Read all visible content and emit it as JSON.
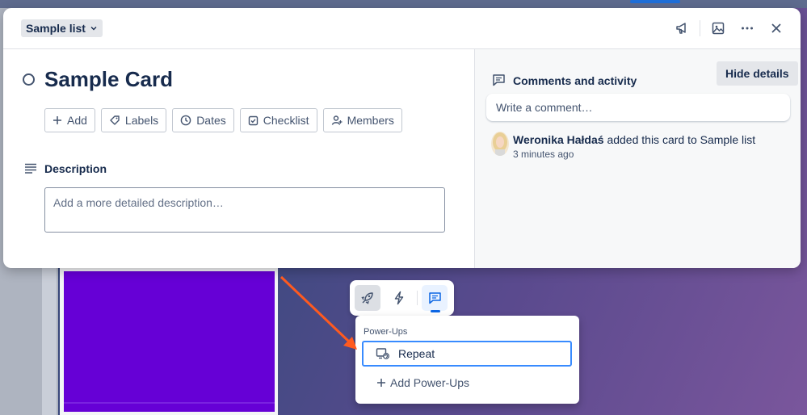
{
  "modal": {
    "list_name": "Sample list",
    "card_title": "Sample Card",
    "actions": [
      "Add",
      "Labels",
      "Dates",
      "Checklist",
      "Members"
    ],
    "description_label": "Description",
    "description_placeholder": "Add a more detailed description…"
  },
  "activity": {
    "title": "Comments and activity",
    "hide_details": "Hide details",
    "comment_placeholder": "Write a comment…",
    "user": "Weronika Hałdaś",
    "action_text": " added this card to Sample list",
    "time": "3 minutes ago"
  },
  "powerups": {
    "heading": "Power-Ups",
    "repeat": "Repeat",
    "add": "Add Power-Ups"
  },
  "colors": {
    "accent": "#0c66e4",
    "cover": "#6600d6",
    "arrow": "#ff5a1f"
  },
  "icons": [
    "chevron-down-icon",
    "megaphone-icon",
    "image-icon",
    "more-icon",
    "close-icon",
    "plus-icon",
    "tag-icon",
    "clock-icon",
    "checkbox-icon",
    "person-icon",
    "description-icon",
    "comment-icon",
    "rocket-icon",
    "bolt-icon",
    "powerup-icon",
    "repeat-icon"
  ]
}
